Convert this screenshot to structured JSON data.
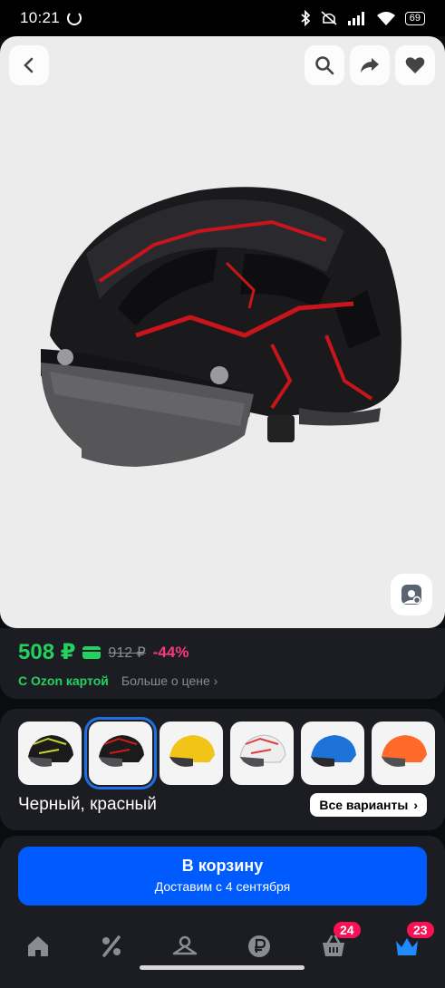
{
  "status_bar": {
    "time": "10:21",
    "battery": "69",
    "icons": [
      "ozon-app-icon",
      "bluetooth-icon",
      "silent-icon",
      "signal-icon",
      "wifi-icon",
      "battery-icon"
    ]
  },
  "hero": {
    "image": "helmet-black-red-visor",
    "buttons": [
      "back-icon",
      "search-icon",
      "share-icon",
      "heart-icon",
      "image-search-icon"
    ]
  },
  "price": {
    "current": "508 ₽",
    "old": "912 ₽",
    "discount": "-44%",
    "with_card": "С Ozon картой",
    "more_label": "Больше о цене",
    "accent": "#23d160",
    "discount_color": "#f53b7b"
  },
  "variants": {
    "selected_color": "Черный, красный",
    "all_label": "Все варианты",
    "items": [
      {
        "name": "black-yellow",
        "color": "#c8d62b"
      },
      {
        "name": "black-red",
        "color": "#d11a1a"
      },
      {
        "name": "yellow",
        "color": "#f2c418"
      },
      {
        "name": "white-red",
        "color": "#e23b3b"
      },
      {
        "name": "blue",
        "color": "#1e73d8"
      },
      {
        "name": "orange",
        "color": "#ff6a2a"
      }
    ]
  },
  "cart": {
    "label": "В корзину",
    "delivery": "Доставим с 4 сентября",
    "color": "#005bff"
  },
  "nav": {
    "items": [
      {
        "icon": "home-icon"
      },
      {
        "icon": "percent-icon"
      },
      {
        "icon": "hanger-icon"
      },
      {
        "icon": "ruble-icon"
      },
      {
        "icon": "cart-icon",
        "badge": "24"
      },
      {
        "icon": "crown-icon",
        "badge": "23"
      }
    ]
  }
}
